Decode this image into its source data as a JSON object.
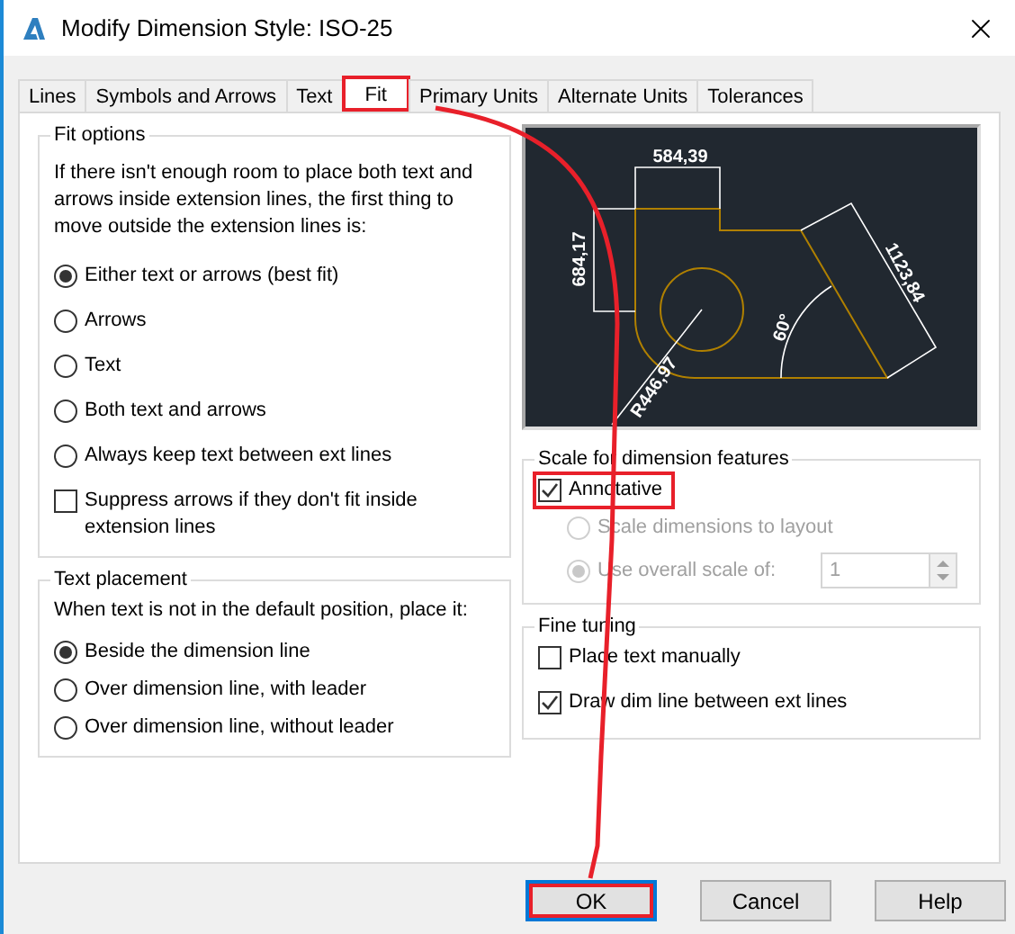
{
  "window": {
    "title": "Modify Dimension Style: ISO-25"
  },
  "tabs": [
    {
      "label": "Lines",
      "selected": false,
      "highlighted": false
    },
    {
      "label": "Symbols and Arrows",
      "selected": false,
      "highlighted": false
    },
    {
      "label": "Text",
      "selected": false,
      "highlighted": false
    },
    {
      "label": "Fit",
      "selected": true,
      "highlighted": true
    },
    {
      "label": "Primary Units",
      "selected": false,
      "highlighted": false
    },
    {
      "label": "Alternate Units",
      "selected": false,
      "highlighted": false
    },
    {
      "label": "Tolerances",
      "selected": false,
      "highlighted": false
    }
  ],
  "fit_options": {
    "title": "Fit options",
    "description": "If there isn't enough room to place both text and arrows inside extension lines, the first thing to move outside the extension lines is:",
    "options": [
      {
        "label": "Either text or arrows (best fit)",
        "selected": true
      },
      {
        "label": "Arrows",
        "selected": false
      },
      {
        "label": "Text",
        "selected": false
      },
      {
        "label": "Both text and arrows",
        "selected": false
      },
      {
        "label": "Always keep text between ext lines",
        "selected": false
      }
    ],
    "suppress_arrows": {
      "label": "Suppress arrows if they don't fit inside extension lines",
      "checked": false
    }
  },
  "text_placement": {
    "title": "Text placement",
    "description": "When text is not in the default position, place it:",
    "options": [
      {
        "label": "Beside the dimension line",
        "selected": true
      },
      {
        "label": "Over dimension line, with leader",
        "selected": false
      },
      {
        "label": "Over dimension line, without leader",
        "selected": false
      }
    ]
  },
  "preview": {
    "labels": [
      "584,39",
      "684,17",
      "1123,84",
      "60°",
      "R446,97"
    ]
  },
  "scale": {
    "title": "Scale for dimension features",
    "annotative": {
      "label": "Annotative",
      "checked": true,
      "highlighted": true
    },
    "options": [
      {
        "label": "Scale dimensions to layout",
        "selected": false,
        "disabled": true
      },
      {
        "label": "Use overall scale of:",
        "selected": true,
        "disabled": true
      }
    ],
    "scale_value": "1"
  },
  "fine_tuning": {
    "title": "Fine tuning",
    "options": [
      {
        "label": "Place text manually",
        "checked": false
      },
      {
        "label": "Draw dim line between ext lines",
        "checked": true
      }
    ]
  },
  "buttons": [
    {
      "label": "OK",
      "focused": true,
      "highlighted": true
    },
    {
      "label": "Cancel",
      "focused": false,
      "highlighted": false
    },
    {
      "label": "Help",
      "focused": false,
      "highlighted": false
    }
  ]
}
